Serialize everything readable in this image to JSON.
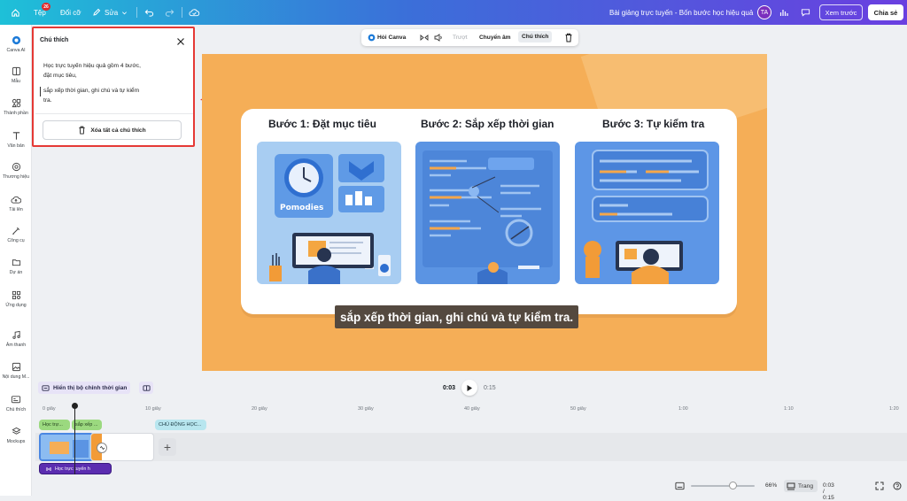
{
  "topbar": {
    "file_label": "Tệp",
    "file_badge": "26",
    "rename_label": "Đổi cỡ",
    "edit_label": "Sửa",
    "doc_title": "Bài giảng trực tuyến - Bốn bước học hiệu quả",
    "avatar_initials": "TA",
    "preview_label": "Xem trước",
    "share_label": "Chia sẻ"
  },
  "rail": {
    "items": [
      {
        "label": "Canva AI",
        "icon": "canva-ai-icon"
      },
      {
        "label": "Mẫu",
        "icon": "template-icon"
      },
      {
        "label": "Thành phần",
        "icon": "elements-icon"
      },
      {
        "label": "Văn bản",
        "icon": "text-icon"
      },
      {
        "label": "Thương hiệu",
        "icon": "brand-icon"
      },
      {
        "label": "Tải lên",
        "icon": "upload-icon"
      },
      {
        "label": "Công cụ",
        "icon": "tools-icon"
      },
      {
        "label": "Dự án",
        "icon": "folder-icon"
      },
      {
        "label": "Ứng dụng",
        "icon": "apps-icon"
      },
      {
        "label": "Âm thanh",
        "icon": "music-icon"
      },
      {
        "label": "Nội dung M...",
        "icon": "media-icon"
      },
      {
        "label": "Chú thích",
        "icon": "caption-icon"
      },
      {
        "label": "Mockups",
        "icon": "mockups-icon"
      }
    ]
  },
  "panel": {
    "title": "Chú thích",
    "line1": "Học trực tuyến hiệu quả gồm 4 bước,",
    "line2": "đặt mục tiêu,",
    "line3": "sắp xếp thời gian, ghi chú và tự kiểm",
    "line4": "tra.",
    "clear_label": "Xóa tất cả chú thích"
  },
  "context_toolbar": {
    "ask_label": "Hỏi Canva",
    "slide_label": "Trượt",
    "transition_label": "Chuyển âm",
    "caption_label": "Chú thích"
  },
  "slide": {
    "steps": [
      {
        "title": "Bước 1: Đặt mục tiêu"
      },
      {
        "title": "Bước 2: Sắp xếp thời gian"
      },
      {
        "title": "Bước 3: Tự kiểm tra"
      }
    ],
    "pomodoro_text": "Pomodies",
    "caption": "sắp xếp thời gian, ghi chú và tự kiểm tra."
  },
  "timeline": {
    "timing_button": "Hiển thị bộ chỉnh thời gian",
    "current_time": "0:03",
    "total_time": "0:15",
    "ruler_labels": [
      "0 giây",
      "10 giây",
      "20 giây",
      "30 giây",
      "40 giây",
      "50 giây",
      "1:00",
      "1:10",
      "1:20"
    ],
    "caption_clips": [
      {
        "label": "Học trự..."
      },
      {
        "label": "sắp xếp ..."
      },
      {
        "label": "CHỦ ĐỘNG HỌC..."
      }
    ],
    "audio_label": "Học trực tuyến h"
  },
  "bottombar": {
    "zoom": "66%",
    "zoom_level": 0.66,
    "pages_label": "Trang",
    "time": "0:03 / 0:15"
  },
  "colors": {
    "accent": "#7d2ae8",
    "highlight_border": "#e53935",
    "canvas_bg": "#f5ae57",
    "caption_green": "#9bd97f",
    "caption_teal": "#b8e6ef"
  }
}
